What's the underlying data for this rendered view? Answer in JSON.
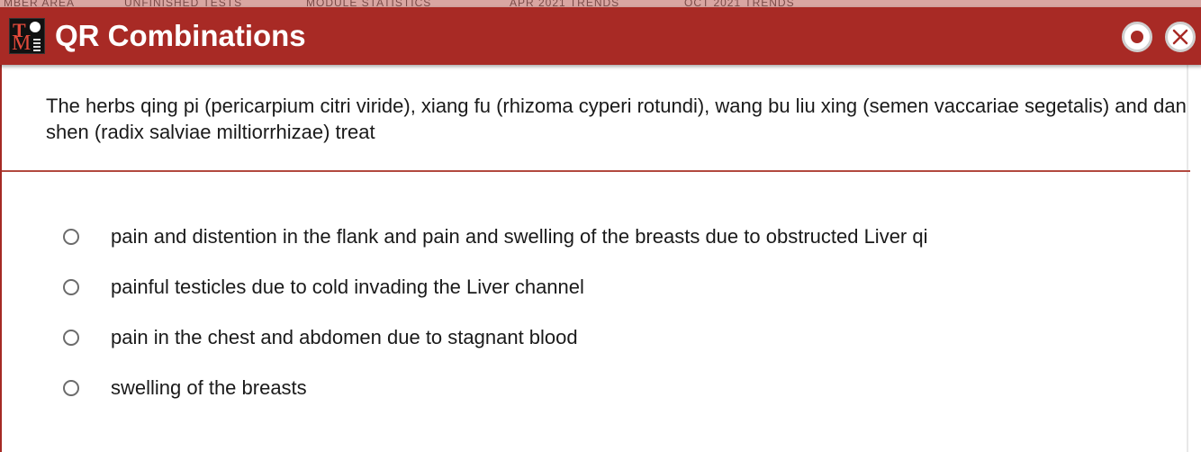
{
  "window": {
    "title": "QR Combinations",
    "accent_color": "#a82a25",
    "logo_icon": "tcmtests-logo-icon"
  },
  "backdrop_tabs": [
    "MBER AREA",
    "UNFINISHED TESTS",
    "MODULE STATISTICS",
    "APR 2021 TRENDS",
    "OCT 2021 TRENDS"
  ],
  "controls": {
    "record_icon": "record-icon",
    "close_icon": "close-icon"
  },
  "question": {
    "text": "The herbs qing pi (pericarpium citri viride), xiang fu (rhizoma cyperi rotundi), wang bu liu xing (semen vaccariae segetalis) and dan shen (radix salviae miltiorrhizae) treat"
  },
  "options": [
    {
      "label": "pain and distention in the flank and pain and swelling of the breasts due to obstructed Liver qi",
      "selected": false
    },
    {
      "label": "painful testicles due to cold invading the Liver channel",
      "selected": false
    },
    {
      "label": "pain in the chest and abdomen due to stagnant blood",
      "selected": false
    },
    {
      "label": "swelling of the breasts",
      "selected": false
    }
  ]
}
